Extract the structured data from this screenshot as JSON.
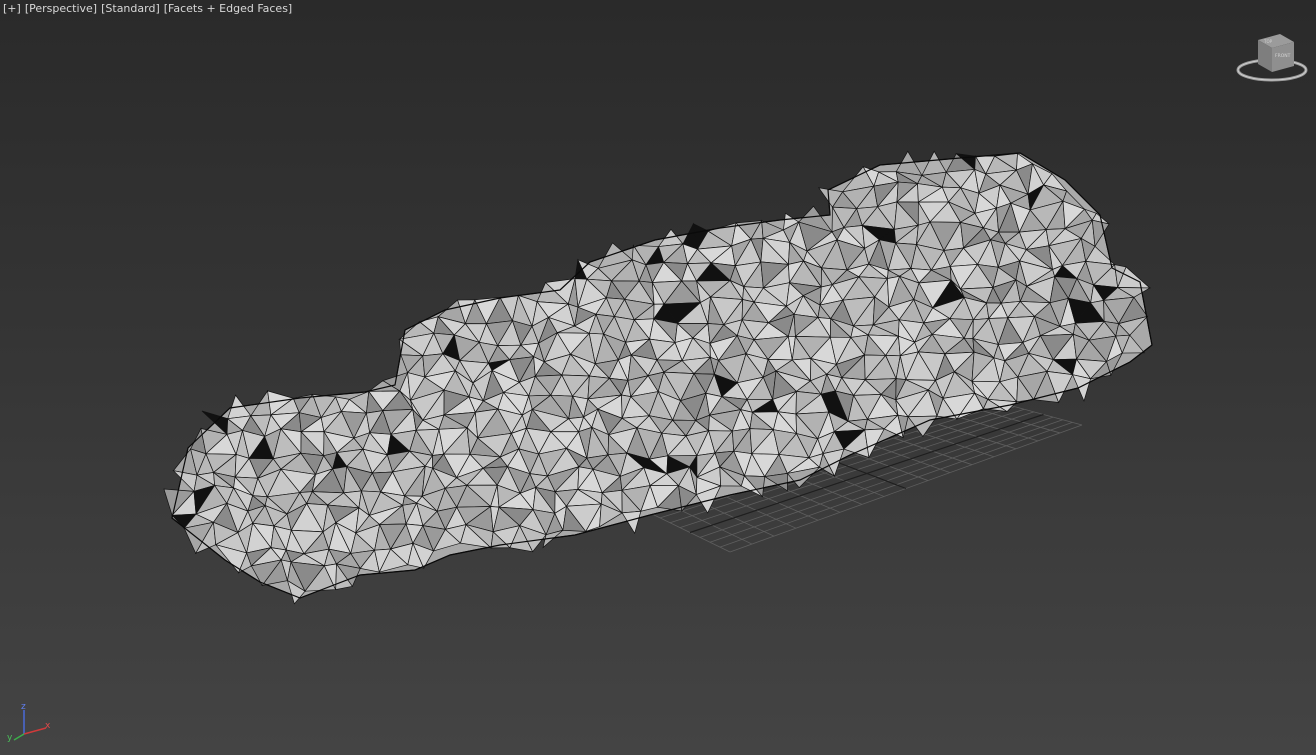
{
  "viewport": {
    "label_plus": "[+]",
    "label_view": "[Perspective]",
    "label_shading": "[Standard]",
    "label_mode": "[Facets + Edged Faces]"
  },
  "viewcube": {
    "face_top": "TOP",
    "face_front": "FRONT",
    "icon": "viewcube-icon"
  },
  "axis": {
    "x": "x",
    "y": "y",
    "z": "z",
    "colors": {
      "x": "#d13a3a",
      "y": "#3ab04a",
      "z": "#4a6ad8"
    }
  },
  "colors": {
    "bg_top": "#2a2a2a",
    "bg_bottom": "#444444",
    "mesh_face": "#bdbdbd",
    "mesh_edge": "#111111",
    "grid": "#6a6a6a"
  }
}
